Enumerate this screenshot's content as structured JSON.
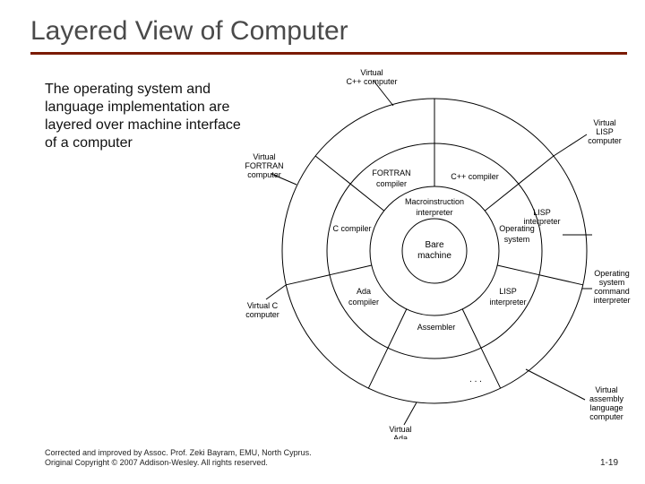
{
  "title": "Layered View of Computer",
  "body_text": "The operating system and language implementation are layered over machine interface of a computer",
  "footer": "Corrected and improved by Assoc. Prof. Zeki Bayram, EMU, North Cyprus. Original Copyright © 2007 Addison-Wesley. All rights reserved.",
  "page_number": "1-19",
  "diagram": {
    "center": "Bare machine",
    "ring2": "Macroinstruction interpreter",
    "ring3": [
      "Operating system",
      "FORTRAN compiler",
      "C compiler",
      "Ada compiler",
      "Assembler",
      "LISP interpreter",
      "C++ compiler"
    ],
    "outer_ellipsis": ". . .",
    "outer_labels": [
      "Virtual C++ computer",
      "Virtual LISP computer",
      "Virtual FORTRAN computer",
      "Virtual C computer",
      "Virtual Ada computer",
      "Virtual assembly language computer",
      "Operating system command interpreter"
    ]
  }
}
